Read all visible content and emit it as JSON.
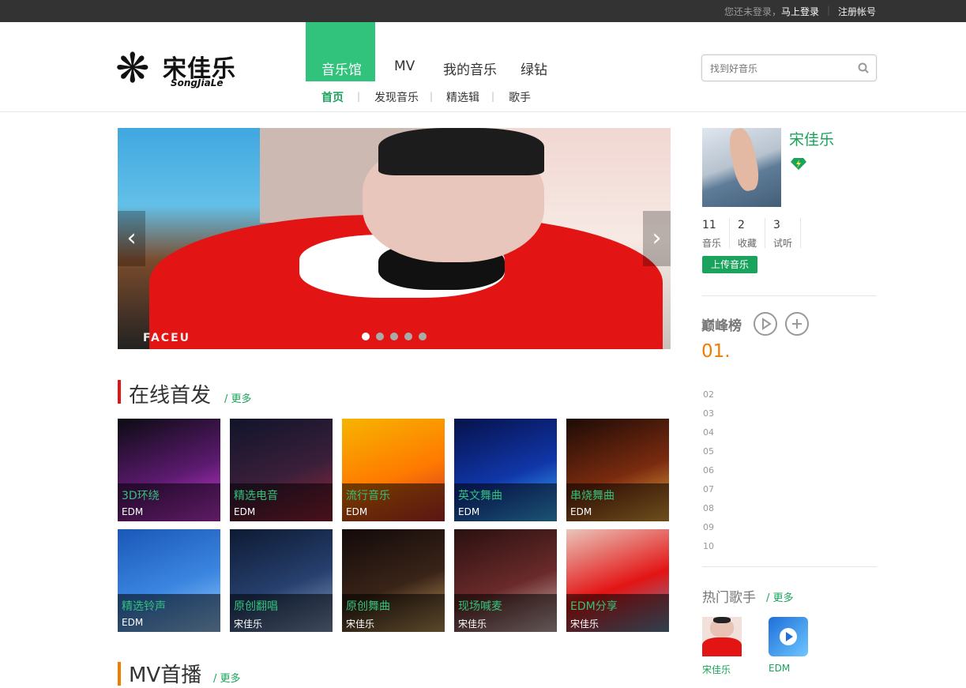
{
  "topbar": {
    "not_logged_in": "您还未登录，",
    "login_link": "马上登录",
    "separator": "|",
    "register_link": "注册帐号"
  },
  "logo": {
    "name": "宋佳乐",
    "sub": "SongJiaLe",
    "icon": "snowflake-logo-icon"
  },
  "nav": {
    "items": [
      {
        "label": "音乐馆",
        "active": true
      },
      {
        "label": "MV",
        "active": false
      },
      {
        "label": "我的音乐",
        "active": false
      },
      {
        "label": "绿钻",
        "active": false
      }
    ],
    "sub_items": [
      {
        "label": "首页",
        "active": true
      },
      {
        "label": "发现音乐",
        "active": false
      },
      {
        "label": "精选辑",
        "active": false
      },
      {
        "label": "歌手",
        "active": false
      }
    ],
    "sub_separator": "|"
  },
  "search": {
    "placeholder": "找到好音乐",
    "icon": "search-icon"
  },
  "banner": {
    "watermark": "FACEU",
    "prev_icon": "chevron-left-icon",
    "next_icon": "chevron-right-icon",
    "slide_count": 5,
    "active_slide": 1,
    "prev_glyph": "‹",
    "next_glyph": "›"
  },
  "online_first": {
    "title": "在线首发",
    "more": "/ 更多"
  },
  "tiles": [
    {
      "title": "3D环绕",
      "tag": "EDM",
      "colors": [
        "#0b0b12",
        "#5b1a6e",
        "#d23de0"
      ]
    },
    {
      "title": "精选电音",
      "tag": "EDM",
      "colors": [
        "#10142a",
        "#3b1f3a",
        "#a2263a"
      ]
    },
    {
      "title": "流行音乐",
      "tag": "EDM",
      "colors": [
        "#f6b400",
        "#ff7a00",
        "#c82f2f"
      ]
    },
    {
      "title": "英文舞曲",
      "tag": "EDM",
      "colors": [
        "#06124a",
        "#1036a8",
        "#3fb8ff"
      ]
    },
    {
      "title": "串烧舞曲",
      "tag": "EDM",
      "colors": [
        "#1c0b06",
        "#7a2b0f",
        "#f0b040"
      ]
    },
    {
      "title": "精选铃声",
      "tag": "EDM",
      "colors": [
        "#1a57b8",
        "#3b86e0",
        "#9fd0ff"
      ]
    },
    {
      "title": "原创翻唱",
      "tag": "宋佳乐",
      "colors": [
        "#0d1a33",
        "#27406e",
        "#8aa4c8"
      ]
    },
    {
      "title": "原创舞曲",
      "tag": "宋佳乐",
      "colors": [
        "#120a0a",
        "#3a2418",
        "#caa060"
      ]
    },
    {
      "title": "现场喊麦",
      "tag": "宋佳乐",
      "colors": [
        "#2a1010",
        "#6a2a2a",
        "#d8c0c0"
      ]
    },
    {
      "title": "EDM分享",
      "tag": "宋佳乐",
      "colors": [
        "#e9c6bb",
        "#e31414",
        "#6a8fb0"
      ]
    }
  ],
  "mv_section": {
    "title": "MV首播",
    "more": "/ 更多"
  },
  "profile": {
    "name": "宋佳乐",
    "badge_icon": "green-diamond-icon",
    "stats": [
      {
        "value": "11",
        "label": "音乐"
      },
      {
        "value": "2",
        "label": "收藏"
      },
      {
        "value": "3",
        "label": "试听"
      }
    ],
    "upload_label": "上传音乐"
  },
  "peak_chart": {
    "title": "巅峰榜",
    "play_icon": "play-circle-icon",
    "add_icon": "plus-circle-icon",
    "first_rank": "01.",
    "ranks": [
      "02",
      "03",
      "04",
      "05",
      "06",
      "07",
      "08",
      "09",
      "10"
    ]
  },
  "hot_singers": {
    "title": "热门歌手",
    "more": "/ 更多",
    "singers": [
      {
        "name": "宋佳乐"
      },
      {
        "name": "EDM"
      }
    ]
  },
  "colors": {
    "accent_green": "#31c27c",
    "link_green": "#1aa35c",
    "topbar": "#333333",
    "section_bar_red": "#e31414",
    "section_bar_orange": "#f07c00",
    "rank_orange": "#f07c00"
  }
}
